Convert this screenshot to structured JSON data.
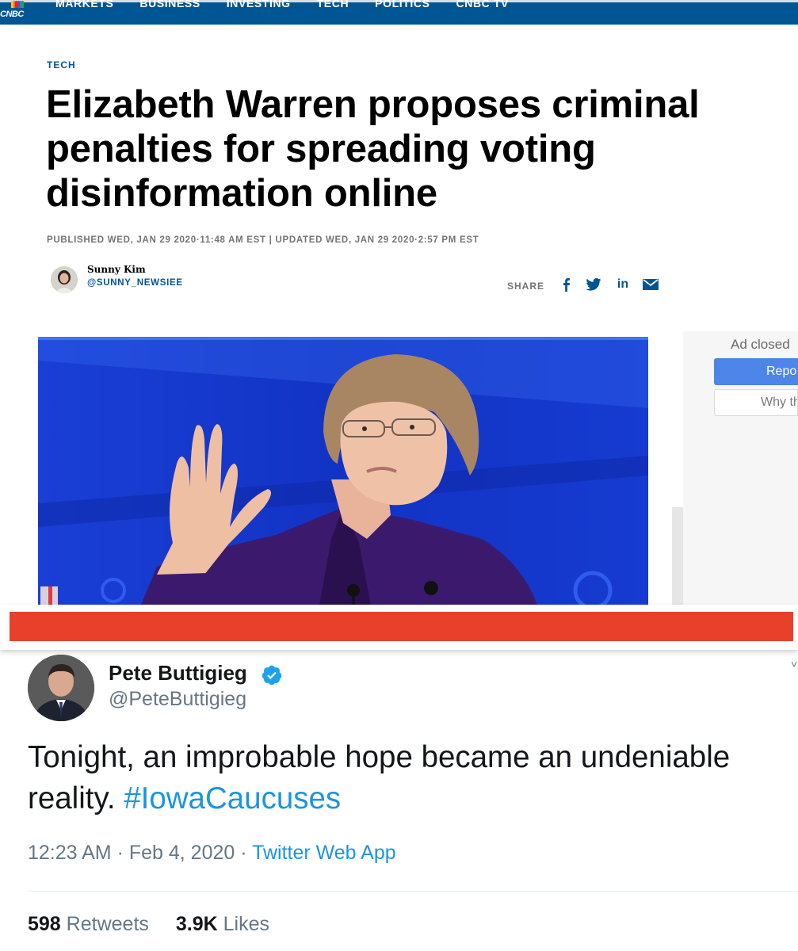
{
  "nav": {
    "logo_text": "CNBC",
    "items": [
      "MARKETS",
      "BUSINESS",
      "INVESTING",
      "TECH",
      "POLITICS",
      "CNBC TV"
    ]
  },
  "article": {
    "kicker": "TECH",
    "headline": "Elizabeth Warren proposes criminal penalties for spreading voting disinformation online",
    "dateline": "PUBLISHED WED, JAN 29 2020·11:48 AM EST | UPDATED WED, JAN 29 2020·2:57 PM EST",
    "author_name": "Sunny Kim",
    "author_handle": "@SUNNY_NEWSIEE",
    "share_label": "SHARE",
    "share_icons": [
      "facebook-icon",
      "twitter-icon",
      "linkedin-icon",
      "email-icon"
    ]
  },
  "ad": {
    "closed_text": "Ad closed",
    "report_label": "Repo",
    "why_label": "Why th"
  },
  "tweet": {
    "name": "Pete Buttigieg",
    "handle": "@PeteButtigieg",
    "text_before": "Tonight, an improbable hope became an undeniable reality. ",
    "hashtag": "#IowaCaucuses",
    "time": "12:23 AM",
    "date": "Feb 4, 2020",
    "app": "Twitter Web App",
    "retweets_count": "598",
    "retweets_label": "Retweets",
    "likes_count": "3.9K",
    "likes_label": "Likes"
  },
  "colors": {
    "cnbc_blue": "#005594",
    "divider_red": "#e8402a",
    "twitter_blue": "#1b95e0",
    "ad_button_blue": "#4d86e8"
  }
}
